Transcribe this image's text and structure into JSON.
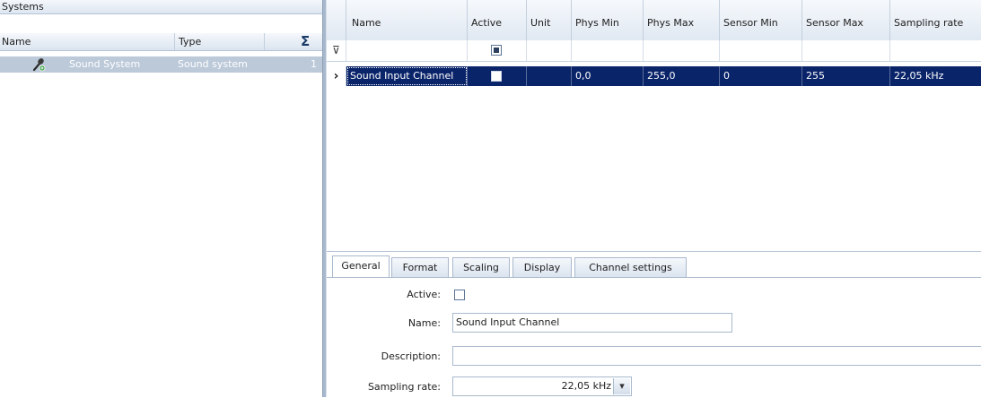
{
  "systems_panel": {
    "title": "Systems",
    "columns": {
      "name": "Name",
      "type": "Type",
      "sum_symbol": "Σ"
    },
    "rows": [
      {
        "name": "Sound System",
        "type": "Sound system",
        "count": "1",
        "icon": "microphone-icon"
      }
    ]
  },
  "channel_grid": {
    "filter_symbol": "⊽",
    "row_indicator": "›",
    "columns": [
      "Name",
      "Active",
      "Unit",
      "Phys Min",
      "Phys Max",
      "Sensor Min",
      "Sensor Max",
      "Sampling rate"
    ],
    "rows": [
      {
        "name": "Sound Input Channel",
        "active": false,
        "unit": "",
        "phys_min": "0,0",
        "phys_max": "255,0",
        "sensor_min": "0",
        "sensor_max": "255",
        "sampling_rate": "22,05 kHz"
      }
    ]
  },
  "tabs": [
    "General",
    "Format",
    "Scaling",
    "Display",
    "Channel settings"
  ],
  "active_tab": "General",
  "general_form": {
    "active_label": "Active:",
    "active_checked": false,
    "name_label": "Name:",
    "name_value": "Sound Input Channel",
    "description_label": "Description:",
    "description_value": "",
    "sampling_rate_label": "Sampling rate:",
    "sampling_rate_value": "22,05 kHz",
    "dropdown_arrow": "▾"
  },
  "colors": {
    "selection": "#0a246a",
    "inactive_selection": "#bcc9d9",
    "header_gradient_top": "#f6f9fc",
    "header_gradient_bottom": "#e0e8f2",
    "border": "#b4c3d6"
  }
}
